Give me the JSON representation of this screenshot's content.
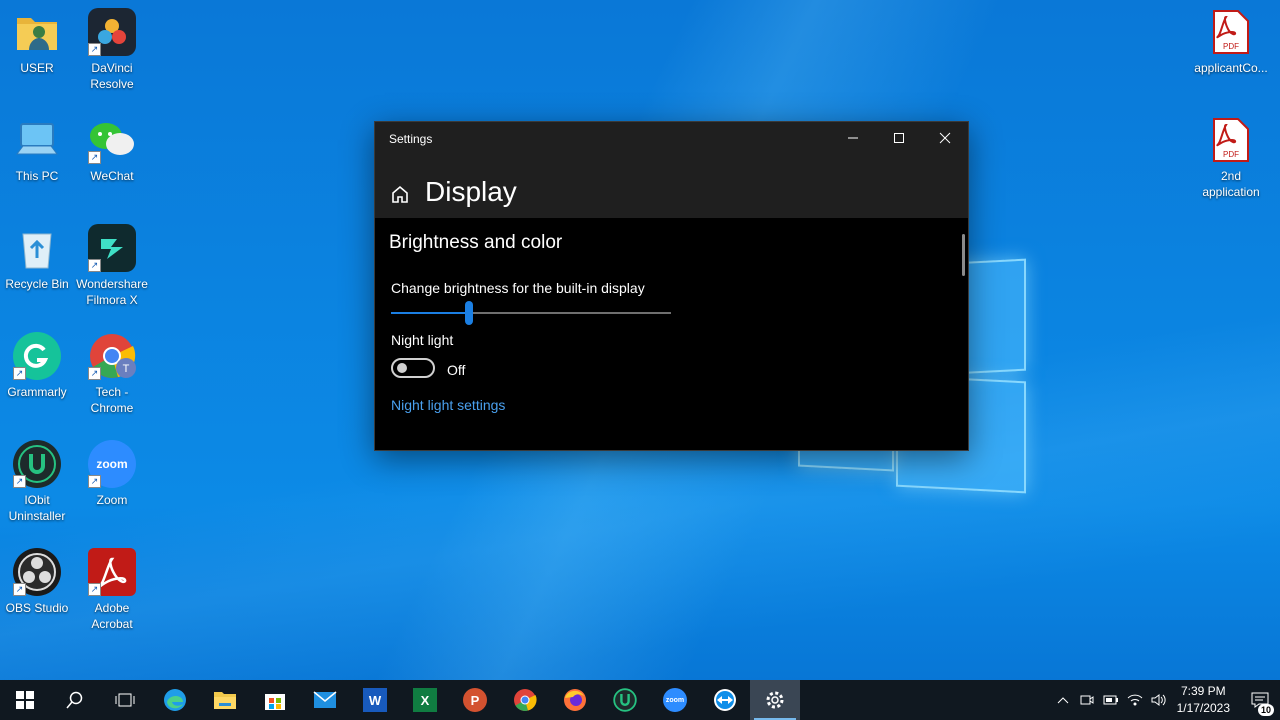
{
  "desktop_icons": [
    {
      "label": "USER",
      "icon": "user-folder-icon"
    },
    {
      "label": "DaVinci Resolve",
      "icon": "davinci-resolve-icon"
    },
    {
      "label": "This PC",
      "icon": "this-pc-icon"
    },
    {
      "label": "WeChat",
      "icon": "wechat-icon"
    },
    {
      "label": "Recycle Bin",
      "icon": "recycle-bin-icon"
    },
    {
      "label": "Wondershare Filmora X",
      "icon": "filmora-icon"
    },
    {
      "label": "Grammarly",
      "icon": "grammarly-icon"
    },
    {
      "label": "Tech - Chrome",
      "icon": "chrome-profile-icon"
    },
    {
      "label": "IObit Uninstaller",
      "icon": "iobit-icon"
    },
    {
      "label": "Zoom",
      "icon": "zoom-icon"
    },
    {
      "label": "OBS Studio",
      "icon": "obs-icon"
    },
    {
      "label": "Adobe Acrobat",
      "icon": "acrobat-icon"
    },
    {
      "label": "applicantCo...",
      "icon": "pdf-file-icon"
    },
    {
      "label": "2nd application",
      "icon": "pdf-file-icon"
    }
  ],
  "pdf_badge": "PDF",
  "chrome_badge": "T",
  "zoom_text": "zoom",
  "settings": {
    "window_title": "Settings",
    "page_title": "Display",
    "section_title": "Brightness and color",
    "brightness_label": "Change brightness for the built-in display",
    "brightness_value": 0.28,
    "night_light_label": "Night light",
    "night_light_state": "Off",
    "night_light_link": "Night light settings"
  },
  "taskbar": {
    "apps": [
      "start-icon",
      "search-icon",
      "task-view-icon",
      "edge-icon",
      "file-explorer-icon",
      "store-icon",
      "mail-icon",
      "word-icon",
      "excel-icon",
      "powerpoint-icon",
      "chrome-icon",
      "firefox-icon",
      "iobit-icon",
      "zoom-icon",
      "teamviewer-icon",
      "settings-icon"
    ],
    "active_app": "settings-icon",
    "word_letter": "W",
    "excel_letter": "X",
    "ppt_letter": "P",
    "time": "7:39 PM",
    "date": "1/17/2023",
    "notification_count": "10"
  },
  "colors": {
    "accent": "#1b7fe3",
    "link": "#4aa0ee",
    "window_bg": "#000000",
    "titlebar_bg": "#1f1f1f",
    "taskbar_bg": "#101820"
  }
}
